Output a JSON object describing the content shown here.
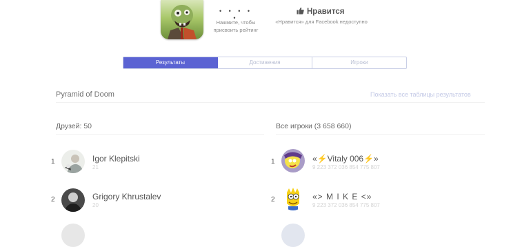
{
  "header": {
    "stars": "• • • • •",
    "rate_line1": "Нажмите, чтобы",
    "rate_line2": "присвоить рейтинг",
    "like_label": "Нравится",
    "like_note": "«Нравится» для Facebook недоступно"
  },
  "tabs": [
    {
      "label": "Результаты",
      "active": true
    },
    {
      "label": "Достижения",
      "active": false
    },
    {
      "label": "Игроки",
      "active": false
    }
  ],
  "leaderboard": {
    "title": "Pyramid of Doom",
    "show_all": "Показать все таблицы результатов"
  },
  "friends": {
    "heading": "Друзей: 50",
    "players": [
      {
        "rank": "1",
        "name": "Igor Klepitski",
        "score": "21"
      },
      {
        "rank": "2",
        "name": "Grigory Khrustalev",
        "score": "20"
      }
    ]
  },
  "all_players": {
    "heading": "Все игроки (3 658 660)",
    "players": [
      {
        "rank": "1",
        "name": "«⚡Vitaly 006⚡»",
        "score": "9 223 372 036 854 775 807"
      },
      {
        "rank": "2",
        "name": "«> M I K E <»",
        "score": "9 223 372 036 854 775 807"
      }
    ]
  },
  "colors": {
    "accent": "#5b63d3",
    "tab_border": "#c9cfe6",
    "muted_link": "#c3c9e6"
  }
}
